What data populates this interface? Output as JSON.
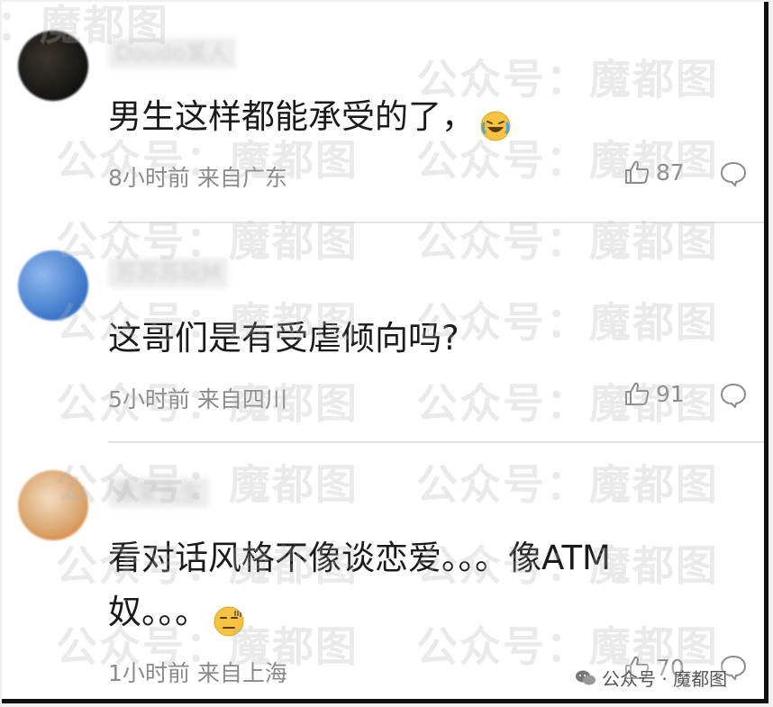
{
  "watermark": "公众号：魔都图",
  "comments": [
    {
      "username": "Doudo某人",
      "text": "男生这样都能承受的了，",
      "emoji": "laughing-tears-emoji",
      "time_location": "8小时前 来自广东",
      "likes": "87"
    },
    {
      "username": "苏苏苏玩M",
      "text": "这哥们是有受虐倾向吗?",
      "time_location": "5小时前 来自四川",
      "likes": "91"
    },
    {
      "username": "蒙蒙先生",
      "text_line1": "看对话风格不像谈恋爱。。。像ATM",
      "text_line2": "奴。。。",
      "emoji": "awkward-sweat-emoji",
      "time_location": "1小时前 来自上海",
      "likes": "70"
    }
  ],
  "account_tag": "公众号 · 魔都图",
  "colors": {
    "text": "#1a1a1a",
    "meta": "#8a8a8a",
    "divider": "#e5e5e5",
    "emoji": "#f6c343"
  }
}
